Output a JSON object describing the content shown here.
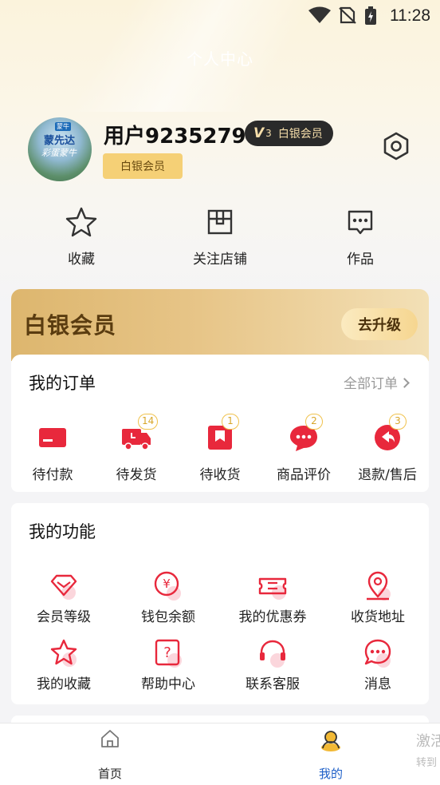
{
  "status_bar": {
    "time": "11:28"
  },
  "header": {
    "title": "个人中心"
  },
  "profile": {
    "avatar_brand_tag": "蒙牛",
    "avatar_text_1": "蒙先达",
    "avatar_text_2": "彩蛋蒙牛",
    "username": "用户92352798",
    "level_letter": "V",
    "level_number": "3",
    "level_name": "白银会员",
    "member_tag": "白银会员"
  },
  "quick_actions": [
    {
      "label": "收藏",
      "icon": "star-icon"
    },
    {
      "label": "关注店铺",
      "icon": "store-icon"
    },
    {
      "label": "作品",
      "icon": "chat-dots-icon"
    }
  ],
  "vip": {
    "title": "白银会员",
    "upgrade_label": "去升级"
  },
  "orders": {
    "title": "我的订单",
    "all_label": "全部订单",
    "items": [
      {
        "label": "待付款",
        "badge": "",
        "icon": "card-icon"
      },
      {
        "label": "待发货",
        "badge": "14",
        "icon": "truck-icon"
      },
      {
        "label": "待收货",
        "badge": "1",
        "icon": "box-icon"
      },
      {
        "label": "商品评价",
        "badge": "2",
        "icon": "comment-icon"
      },
      {
        "label": "退款/售后",
        "badge": "3",
        "icon": "refund-icon"
      }
    ]
  },
  "functions": {
    "title": "我的功能",
    "items": [
      {
        "label": "会员等级",
        "icon": "diamond-icon"
      },
      {
        "label": "钱包余额",
        "icon": "wallet-icon"
      },
      {
        "label": "我的优惠券",
        "icon": "coupon-icon"
      },
      {
        "label": "收货地址",
        "icon": "location-icon"
      },
      {
        "label": "我的收藏",
        "icon": "star-icon"
      },
      {
        "label": "帮助中心",
        "icon": "help-icon"
      },
      {
        "label": "联系客服",
        "icon": "headset-icon"
      },
      {
        "label": "消息",
        "icon": "message-icon"
      }
    ]
  },
  "tabbar": {
    "home_label": "首页",
    "mine_label": "我的",
    "extra_line_1": "激活",
    "extra_line_2": "转到"
  },
  "colors": {
    "accent_red": "#e8283c",
    "badge_gold": "#f0c24d",
    "vip_gold": "#ddb66e",
    "active_blue": "#1e5fc8"
  }
}
